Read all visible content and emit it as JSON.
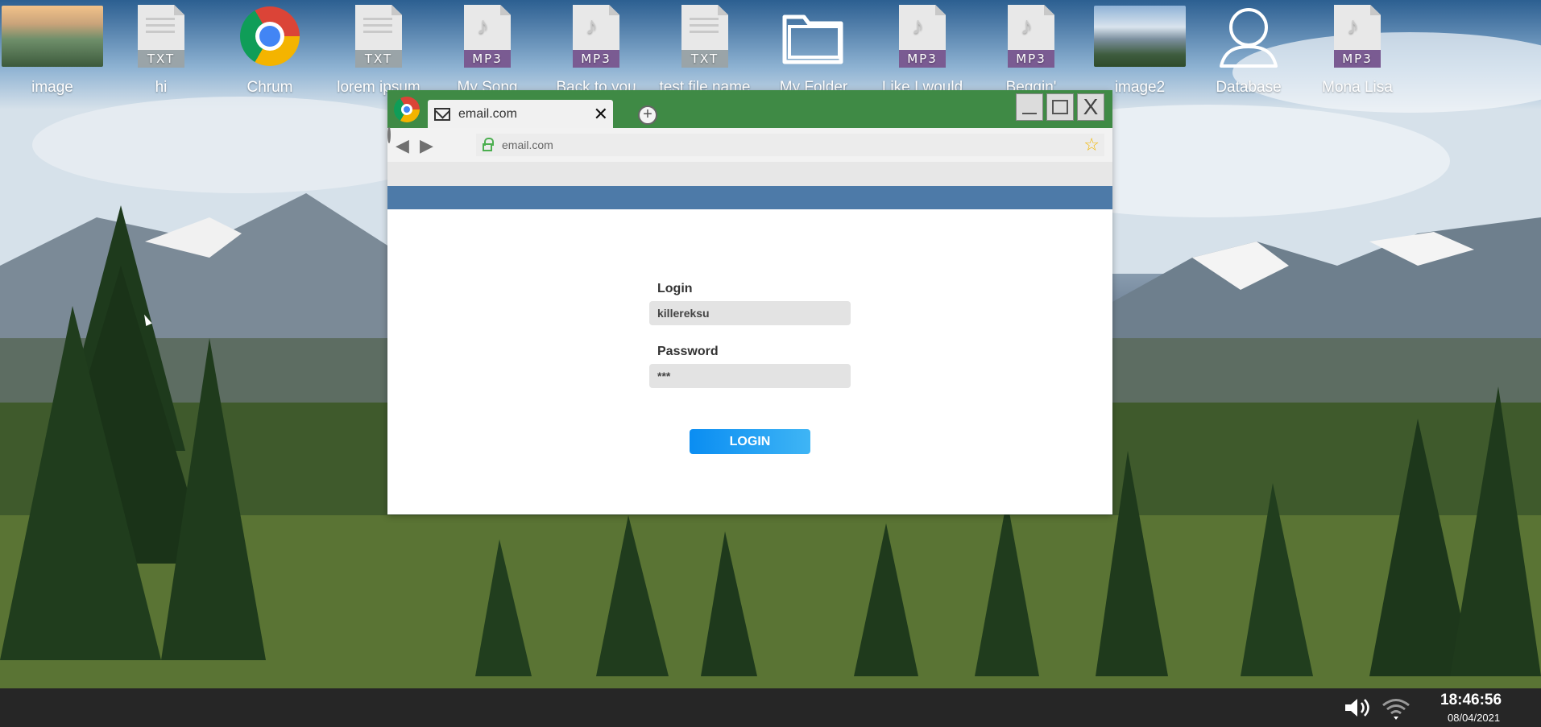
{
  "desktop": {
    "icons": [
      {
        "label": "image",
        "type": "image"
      },
      {
        "label": "hi",
        "type": "txt",
        "badge": "TXT"
      },
      {
        "label": "Chrum",
        "type": "chrome"
      },
      {
        "label": "lorem ipsum",
        "type": "txt",
        "badge": "TXT"
      },
      {
        "label": "My Song",
        "type": "mp3",
        "badge": "MP3"
      },
      {
        "label": "Back to you",
        "type": "mp3",
        "badge": "MP3"
      },
      {
        "label": "test file name",
        "type": "txt",
        "badge": "TXT"
      },
      {
        "label": "My Folder",
        "type": "folder"
      },
      {
        "label": "Like I would",
        "type": "mp3",
        "badge": "MP3"
      },
      {
        "label": "Beggin'",
        "type": "mp3",
        "badge": "MP3"
      },
      {
        "label": "image2",
        "type": "image"
      },
      {
        "label": "Database",
        "type": "person"
      },
      {
        "label": "Mona Lisa",
        "type": "mp3",
        "badge": "MP3"
      }
    ]
  },
  "browser": {
    "tab_title": "email.com",
    "tab_close": "✕",
    "new_tab": "+",
    "address": "email.com",
    "window_close": "X",
    "colors": {
      "title_bar": "#3f8a45",
      "site_header": "#4d7aa8",
      "login_button": "#1a9bf0"
    }
  },
  "login": {
    "login_label": "Login",
    "login_value": "killereksu",
    "password_label": "Password",
    "password_value": "***",
    "button_label": "LOGIN"
  },
  "taskbar": {
    "time": "18:46:56",
    "date": "08/04/2021",
    "icons": [
      "volume-icon",
      "wifi-icon"
    ]
  }
}
